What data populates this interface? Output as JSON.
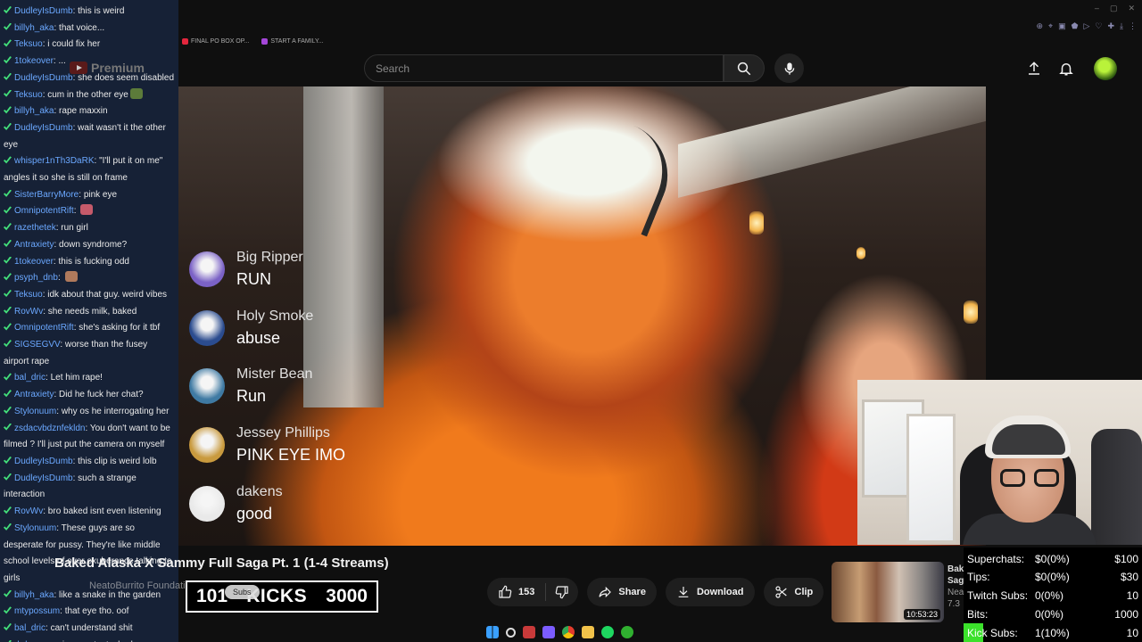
{
  "browser": {
    "bookmarks": [
      {
        "label": "FINAL PO BOX OP...",
        "color": "#e3263d"
      },
      {
        "label": "START A FAMILY...",
        "color": "#a446d8"
      }
    ]
  },
  "youtube": {
    "logo_text": "Premium",
    "search_placeholder": "Search",
    "video_title": "Baked Alaska X Sammy Full Saga Pt. 1 (1-4 Streams)",
    "channel_name": "NeatoBurrito Foundation",
    "like_count": "153",
    "share_label": "Share",
    "download_label": "Download",
    "clip_label": "Clip",
    "subscribe_label": "Subs",
    "suggested_duration": "10:53:23",
    "suggested_meta": [
      "Bak",
      "Saga",
      "Nea",
      "7.3"
    ]
  },
  "kicks_bar": {
    "left": "101",
    "label": "KICKS",
    "right": "3000"
  },
  "video_overlay_chat": [
    {
      "user": "Big Ripper",
      "message": "RUN",
      "avatar_color": "#7b62c6"
    },
    {
      "user": "Holy Smoke",
      "message": "abuse",
      "avatar_color": "#2b4c8f"
    },
    {
      "user": "Mister Bean",
      "message": "Run",
      "avatar_color": "#3f7aa3"
    },
    {
      "user": "Jessey Phillips",
      "message": "PINK EYE IMO",
      "avatar_color": "#c99a3e"
    },
    {
      "user": "dakens",
      "message": "good",
      "avatar_color": "#e9e9e9"
    }
  ],
  "side_chat": [
    {
      "user": "DudleyIsDumb",
      "text": "this is weird"
    },
    {
      "user": "billyh_aka",
      "text": "that voice..."
    },
    {
      "user": "Teksuo",
      "text": "i could fix her"
    },
    {
      "user": "1tokeover",
      "text": "..."
    },
    {
      "user": "DudleyIsDumb",
      "text": "she does seem disabled"
    },
    {
      "user": "Teksuo",
      "text": "cum in the other eye",
      "emote": "#5c7b3a"
    },
    {
      "user": "billyh_aka",
      "text": "rape maxxin"
    },
    {
      "user": "DudleyIsDumb",
      "text": "wait wasn't it the other eye"
    },
    {
      "user": "whisper1nTh3DaRK",
      "text": "\"I'll put it on me\" angles it so she is still on frame"
    },
    {
      "user": "SisterBarryMore",
      "text": "pink eye"
    },
    {
      "user": "OmnipotentRift",
      "text": "",
      "emote": "#c55a6a"
    },
    {
      "user": "razethetek",
      "text": "run girl"
    },
    {
      "user": "Antraxiety",
      "text": "down syndrome?"
    },
    {
      "user": "1tokeover",
      "text": "this is fucking odd"
    },
    {
      "user": "psyph_dnb",
      "text": "",
      "emote": "#b07a5c"
    },
    {
      "user": "Teksuo",
      "text": "idk about that guy. weird vibes"
    },
    {
      "user": "RovWv",
      "text": "she needs milk, baked"
    },
    {
      "user": "OmnipotentRift",
      "text": "she's asking for it tbf"
    },
    {
      "user": "SIGSEGVV",
      "text": "worse than the fusey airport rape"
    },
    {
      "user": "bal_dric",
      "text": "Let him rape!"
    },
    {
      "user": "Antraxiety",
      "text": "Did he fuck her chat?"
    },
    {
      "user": "Stylonuum",
      "text": "why os he interrogating her"
    },
    {
      "user": "zsdacvbdznfekldn",
      "text": "You don't want to be filmed ? I'll just put the camera on myself"
    },
    {
      "user": "DudleyIsDumb",
      "text": "this clip is weird lolb"
    },
    {
      "user": "DudleyIsDumb",
      "text": "such a strange interaction"
    },
    {
      "user": "RovWv",
      "text": "bro baked isnt even listening"
    },
    {
      "user": "Stylonuum",
      "text": "These guys are so desperate for pussy. They're like middle school levels of over exuberance talking to girls"
    },
    {
      "user": "billyh_aka",
      "text": "like a snake in the garden"
    },
    {
      "user": "mtypossum",
      "text": "that eye tho. oof"
    },
    {
      "user": "bal_dric",
      "text": "can't understand shit"
    },
    {
      "user": "drdaman",
      "text": "primo content, chud"
    }
  ],
  "stats": [
    {
      "key": "Superchats:",
      "value": "$0(0%)",
      "goal": "$100"
    },
    {
      "key": "Tips:",
      "value": "$0(0%)",
      "goal": "$30"
    },
    {
      "key": "Twitch Subs:",
      "value": "0(0%)",
      "goal": "10"
    },
    {
      "key": "Bits:",
      "value": "0(0%)",
      "goal": "1000"
    },
    {
      "key": "Kick Subs:",
      "value": "1(10%)",
      "goal": "10"
    }
  ],
  "colors": {
    "chat_bg": "#172238",
    "username": "#6ba8ff",
    "kick_green": "#3be12b",
    "accent_red": "#ff0000"
  }
}
